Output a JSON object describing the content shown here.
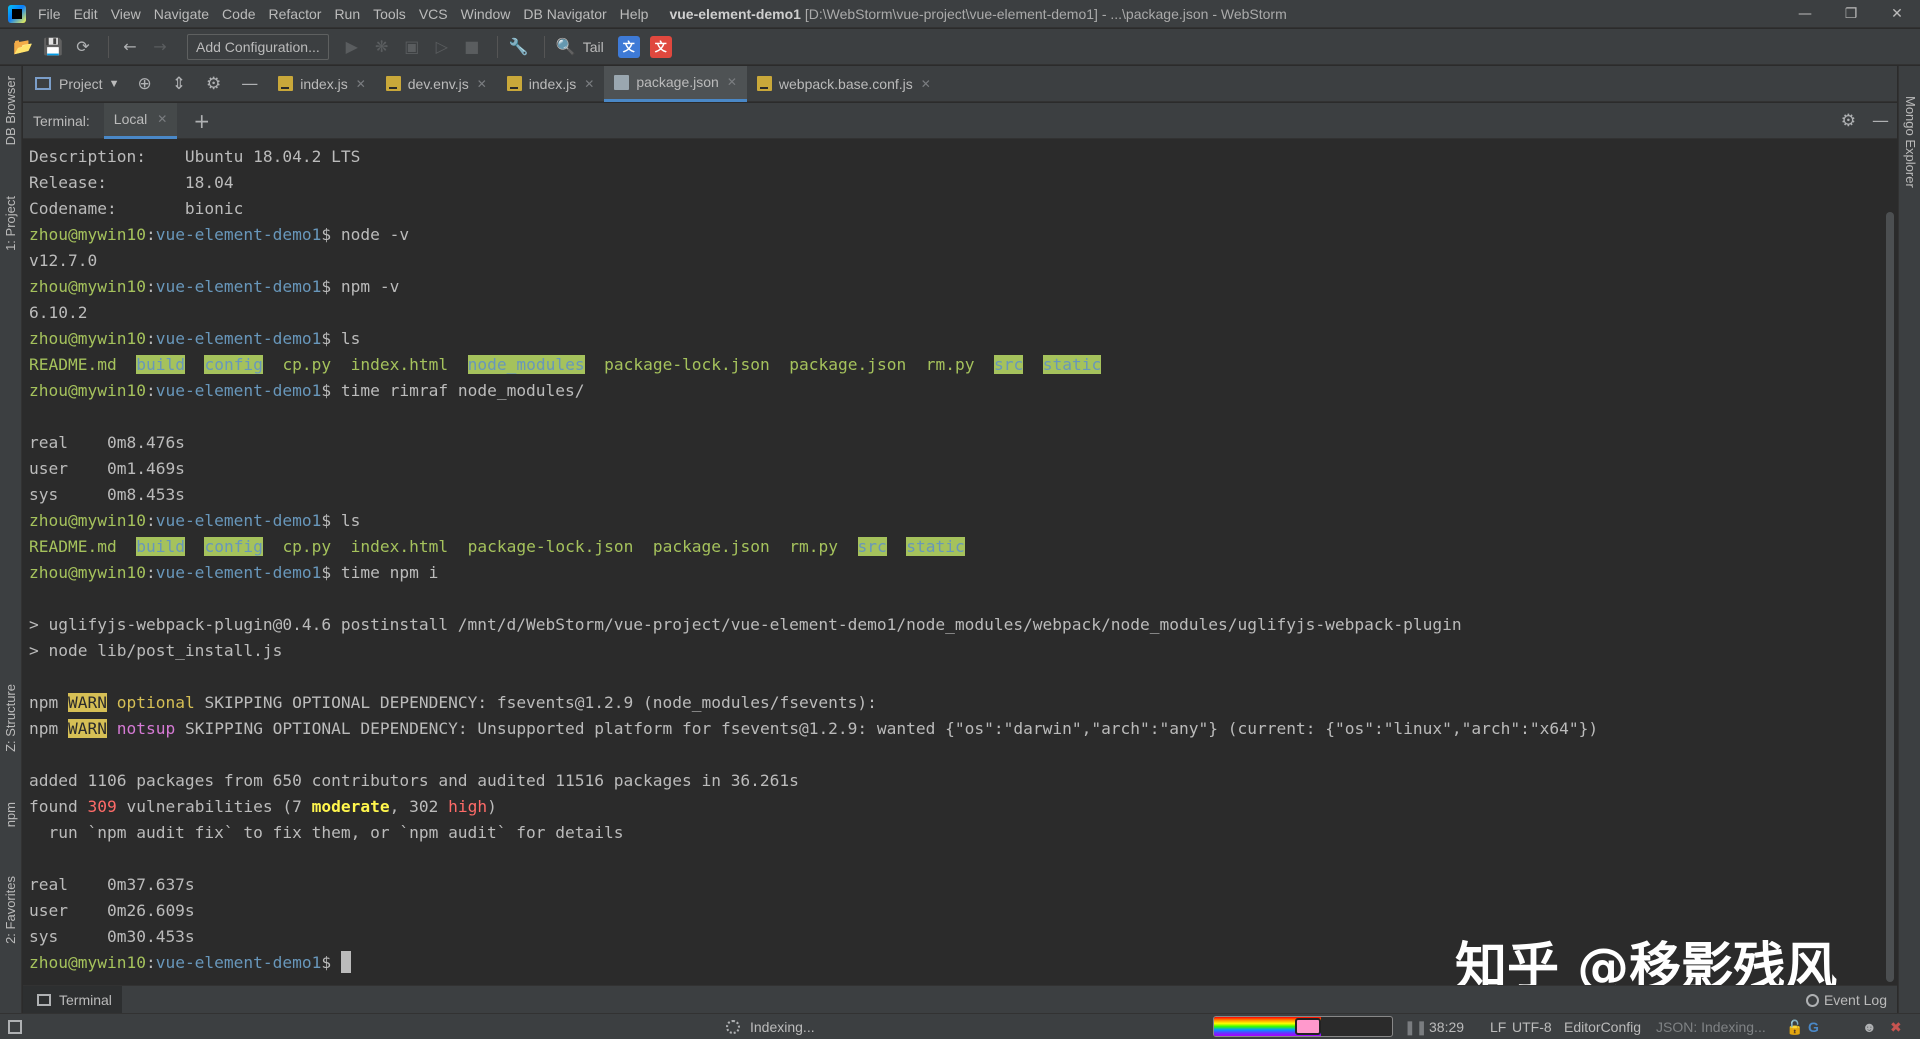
{
  "window": {
    "project_name": "vue-element-demo1",
    "title_rest": " [D:\\WebStorm\\vue-project\\vue-element-demo1] - ...\\package.json - WebStorm"
  },
  "menu": [
    "File",
    "Edit",
    "View",
    "Navigate",
    "Code",
    "Refactor",
    "Run",
    "Tools",
    "VCS",
    "Window",
    "DB Navigator",
    "Help"
  ],
  "toolbar": {
    "add_configuration": "Add Configuration...",
    "tail": "Tail"
  },
  "left_tabs": {
    "db_browser": "DB Browser",
    "project": "1: Project",
    "structure": "Z: Structure",
    "npm": "npm",
    "favorites": "2: Favorites"
  },
  "right_tabs": {
    "mongo": "Mongo Explorer"
  },
  "tabbar": {
    "project_label": "Project",
    "tabs": [
      {
        "name": "index.js",
        "type": "js"
      },
      {
        "name": "dev.env.js",
        "type": "js"
      },
      {
        "name": "index.js",
        "type": "js"
      },
      {
        "name": "package.json",
        "type": "json",
        "active": true
      },
      {
        "name": "webpack.base.conf.js",
        "type": "js"
      }
    ]
  },
  "terminal": {
    "label": "Terminal:",
    "session_tab": "Local",
    "prompt_user": "zhou@mywin10",
    "prompt_dir": "vue-element-demo1",
    "prompt_sep": ":",
    "prompt_suffix": "$ ",
    "lines": [
      {
        "t": "plain",
        "text": "Description:    Ubuntu 18.04.2 LTS"
      },
      {
        "t": "plain",
        "text": "Release:        18.04"
      },
      {
        "t": "plain",
        "text": "Codename:       bionic"
      },
      {
        "t": "prompt",
        "cmd": "node -v"
      },
      {
        "t": "plain",
        "text": "v12.7.0"
      },
      {
        "t": "prompt",
        "cmd": "npm -v"
      },
      {
        "t": "plain",
        "text": "6.10.2"
      },
      {
        "t": "prompt",
        "cmd": "ls"
      },
      {
        "t": "ls",
        "items": [
          {
            "n": "README.md",
            "k": "file"
          },
          {
            "n": "build",
            "k": "dir"
          },
          {
            "n": "config",
            "k": "dir"
          },
          {
            "n": "cp.py",
            "k": "file"
          },
          {
            "n": "index.html",
            "k": "file"
          },
          {
            "n": "node_modules",
            "k": "dir"
          },
          {
            "n": "package-lock.json",
            "k": "file"
          },
          {
            "n": "package.json",
            "k": "file"
          },
          {
            "n": "rm.py",
            "k": "file"
          },
          {
            "n": "src",
            "k": "dir"
          },
          {
            "n": "static",
            "k": "dir"
          }
        ]
      },
      {
        "t": "prompt",
        "cmd": "time rimraf node_modules/"
      },
      {
        "t": "plain",
        "text": ""
      },
      {
        "t": "plain",
        "text": "real    0m8.476s"
      },
      {
        "t": "plain",
        "text": "user    0m1.469s"
      },
      {
        "t": "plain",
        "text": "sys     0m8.453s"
      },
      {
        "t": "prompt",
        "cmd": "ls"
      },
      {
        "t": "ls",
        "items": [
          {
            "n": "README.md",
            "k": "file"
          },
          {
            "n": "build",
            "k": "dir"
          },
          {
            "n": "config",
            "k": "dir"
          },
          {
            "n": "cp.py",
            "k": "file"
          },
          {
            "n": "index.html",
            "k": "file"
          },
          {
            "n": "package-lock.json",
            "k": "file"
          },
          {
            "n": "package.json",
            "k": "file"
          },
          {
            "n": "rm.py",
            "k": "file"
          },
          {
            "n": "src",
            "k": "dir"
          },
          {
            "n": "static",
            "k": "dir"
          }
        ]
      },
      {
        "t": "prompt",
        "cmd": "time npm i"
      },
      {
        "t": "plain",
        "text": ""
      },
      {
        "t": "plain",
        "text": "> uglifyjs-webpack-plugin@0.4.6 postinstall /mnt/d/WebStorm/vue-project/vue-element-demo1/node_modules/webpack/node_modules/uglifyjs-webpack-plugin"
      },
      {
        "t": "plain",
        "text": "> node lib/post_install.js"
      },
      {
        "t": "plain",
        "text": ""
      },
      {
        "t": "warn",
        "kind": "optional",
        "text": "SKIPPING OPTIONAL DEPENDENCY: fsevents@1.2.9 (node_modules/fsevents):"
      },
      {
        "t": "warn",
        "kind": "notsup",
        "text": "SKIPPING OPTIONAL DEPENDENCY: Unsupported platform for fsevents@1.2.9: wanted {\"os\":\"darwin\",\"arch\":\"any\"} (current: {\"os\":\"linux\",\"arch\":\"x64\"})"
      },
      {
        "t": "plain",
        "text": ""
      },
      {
        "t": "plain",
        "text": "added 1106 packages from 650 contributors and audited 11516 packages in 36.261s"
      },
      {
        "t": "vuln",
        "pre": "found ",
        "count": "309",
        "mid": " vulnerabilities (7 ",
        "moderate": "moderate",
        "sep": ", 302 ",
        "high": "high",
        "post": ")"
      },
      {
        "t": "plain",
        "text": "  run `npm audit fix` to fix them, or `npm audit` for details"
      },
      {
        "t": "plain",
        "text": ""
      },
      {
        "t": "plain",
        "text": "real    0m37.637s"
      },
      {
        "t": "plain",
        "text": "user    0m26.609s"
      },
      {
        "t": "plain",
        "text": "sys     0m30.453s"
      },
      {
        "t": "prompt",
        "cmd": "",
        "cursor": true
      }
    ],
    "npm_label": "npm",
    "warn_label": "WARN"
  },
  "watermark": "知乎 @移影残风",
  "bottom_bar": {
    "terminal": "Terminal",
    "event_log": "Event Log"
  },
  "status": {
    "indexing": "Indexing...",
    "position": "38:29",
    "line_sep": "LF",
    "encoding": "UTF-8",
    "editorconfig": "EditorConfig",
    "json_schema": "JSON: Indexing...",
    "progress": 0.6
  },
  "colors": {
    "prompt_user": "#a5c25c",
    "prompt_dir": "#6897bb",
    "dir_bg": "#a5c25c",
    "warn_bg": "#d6bf55",
    "accent": "#4a88c7"
  }
}
